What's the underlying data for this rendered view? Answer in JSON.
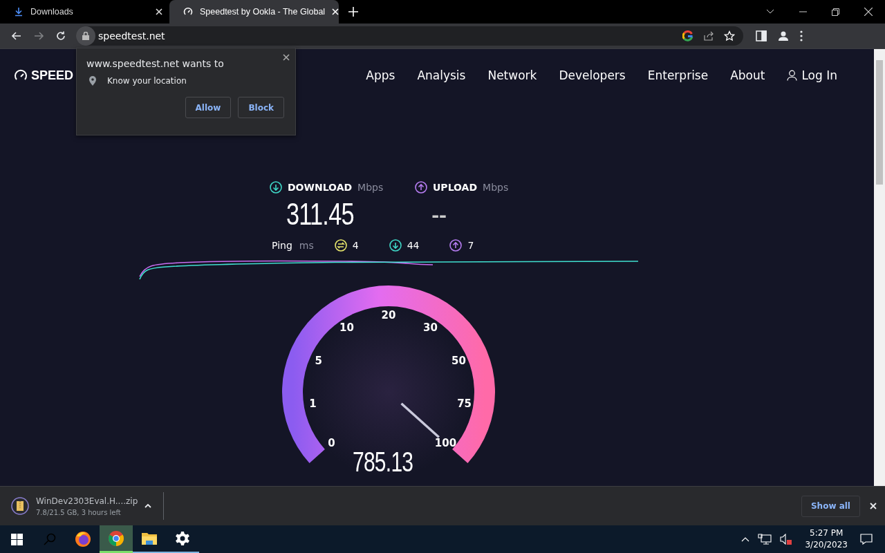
{
  "browser": {
    "tabs": [
      {
        "title": "Downloads",
        "kind": "downloads",
        "selected": false
      },
      {
        "title": "Speedtest by Ookla - The Global",
        "kind": "speedtest",
        "selected": true
      }
    ],
    "nav_buttons": [
      {
        "kind": "back",
        "disabled": false
      },
      {
        "kind": "forward",
        "disabled": true
      },
      {
        "kind": "reload",
        "disabled": false
      }
    ],
    "url": "speedtest.net"
  },
  "permission_popup": {
    "title": "www.speedtest.net wants to",
    "request": "Know your location",
    "buttons": [
      "Allow",
      "Block"
    ]
  },
  "site": {
    "logo": "SPEED",
    "nav": [
      {
        "label": "Apps",
        "kind": "link"
      },
      {
        "label": "Analysis",
        "kind": "link"
      },
      {
        "label": "Network",
        "kind": "link"
      },
      {
        "label": "Developers",
        "kind": "link"
      },
      {
        "label": "Enterprise",
        "kind": "link"
      },
      {
        "label": "About",
        "kind": "link"
      },
      {
        "label": "Log In",
        "kind": "login"
      }
    ],
    "results": [
      {
        "kind": "download",
        "label": "DOWNLOAD",
        "unit": "Mbps",
        "value": "311.45",
        "color": "#3fd6c6"
      },
      {
        "kind": "upload",
        "label": "UPLOAD",
        "unit": "Mbps",
        "value": "--",
        "color": "#b57cf0"
      }
    ],
    "ping": {
      "label": "Ping",
      "unit": "ms",
      "stats": [
        {
          "kind": "jitter",
          "value": "4",
          "color": "#e6e56b"
        },
        {
          "kind": "download",
          "value": "44",
          "color": "#3fd6c6"
        },
        {
          "kind": "upload",
          "value": "7",
          "color": "#b57cf0"
        }
      ]
    },
    "gauge": {
      "labels": [
        "0",
        "1",
        "5",
        "10",
        "20",
        "30",
        "50",
        "75",
        "100"
      ],
      "reading": "785.13"
    }
  },
  "downloads_bar": {
    "item": {
      "name": "WinDev2303Eval.H....zip",
      "status": "7.8/21.5 GB, 3 hours left"
    },
    "show_all": "Show all"
  },
  "taskbar": {
    "apps": [
      {
        "kind": "search",
        "running": false,
        "active": false
      },
      {
        "kind": "firefox",
        "running": false,
        "active": false
      },
      {
        "kind": "chrome",
        "running": true,
        "active": true
      },
      {
        "kind": "explorer",
        "running": true,
        "active": false
      },
      {
        "kind": "settings",
        "running": true,
        "active": false
      }
    ],
    "time": "5:27 PM",
    "date": "3/20/2023"
  }
}
